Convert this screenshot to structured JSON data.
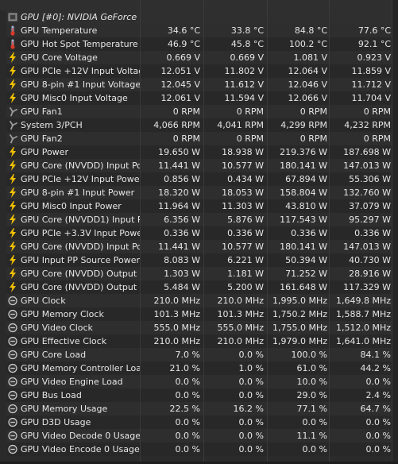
{
  "group": {
    "label": "GPU [#0]: NVIDIA GeForce ..."
  },
  "rows": [
    {
      "icon": "thermometer-icon",
      "label": "GPU Temperature",
      "current": "34.6 °C",
      "min": "33.8 °C",
      "max": "84.8 °C",
      "avg": "77.6 °C"
    },
    {
      "icon": "thermometer-icon",
      "label": "GPU Hot Spot Temperature",
      "current": "46.9 °C",
      "min": "45.8 °C",
      "max": "100.2 °C",
      "avg": "92.1 °C"
    },
    {
      "icon": "lightning-icon",
      "label": "GPU Core Voltage",
      "current": "0.669 V",
      "min": "0.669 V",
      "max": "1.081 V",
      "avg": "0.923 V"
    },
    {
      "icon": "lightning-icon",
      "label": "GPU PCIe +12V Input Voltage",
      "current": "12.051 V",
      "min": "11.802 V",
      "max": "12.064 V",
      "avg": "11.859 V"
    },
    {
      "icon": "lightning-icon",
      "label": "GPU 8-pin #1 Input Voltage",
      "current": "12.045 V",
      "min": "11.612 V",
      "max": "12.046 V",
      "avg": "11.712 V"
    },
    {
      "icon": "lightning-icon",
      "label": "GPU Misc0 Input Voltage",
      "current": "12.061 V",
      "min": "11.594 V",
      "max": "12.066 V",
      "avg": "11.704 V"
    },
    {
      "icon": "fan-icon",
      "label": "GPU Fan1",
      "current": "0 RPM",
      "min": "0 RPM",
      "max": "0 RPM",
      "avg": "0 RPM"
    },
    {
      "icon": "fan-icon",
      "label": "System 3/PCH",
      "current": "4,066 RPM",
      "min": "4,041 RPM",
      "max": "4,299 RPM",
      "avg": "4,232 RPM"
    },
    {
      "icon": "fan-icon",
      "label": "GPU Fan2",
      "current": "0 RPM",
      "min": "0 RPM",
      "max": "0 RPM",
      "avg": "0 RPM"
    },
    {
      "icon": "lightning-icon",
      "label": "GPU Power",
      "current": "19.650 W",
      "min": "18.938 W",
      "max": "219.376 W",
      "avg": "187.698 W"
    },
    {
      "icon": "lightning-icon",
      "label": "GPU Core (NVVDD) Input Po...",
      "current": "11.441 W",
      "min": "10.577 W",
      "max": "180.141 W",
      "avg": "147.013 W"
    },
    {
      "icon": "lightning-icon",
      "label": "GPU PCIe +12V Input Power",
      "current": "0.856 W",
      "min": "0.434 W",
      "max": "67.894 W",
      "avg": "55.306 W"
    },
    {
      "icon": "lightning-icon",
      "label": "GPU 8-pin #1 Input Power",
      "current": "18.320 W",
      "min": "18.053 W",
      "max": "158.804 W",
      "avg": "132.760 W"
    },
    {
      "icon": "lightning-icon",
      "label": "GPU Misc0 Input Power",
      "current": "11.964 W",
      "min": "11.303 W",
      "max": "43.810 W",
      "avg": "37.079 W"
    },
    {
      "icon": "lightning-icon",
      "label": "GPU Core (NVVDD1) Input P...",
      "current": "6.356 W",
      "min": "5.876 W",
      "max": "117.543 W",
      "avg": "95.297 W"
    },
    {
      "icon": "lightning-icon",
      "label": "GPU PCIe +3.3V Input Powe...",
      "current": "0.336 W",
      "min": "0.336 W",
      "max": "0.336 W",
      "avg": "0.336 W"
    },
    {
      "icon": "lightning-icon",
      "label": "GPU Core (NVVDD) Input Po...",
      "current": "11.441 W",
      "min": "10.577 W",
      "max": "180.141 W",
      "avg": "147.013 W"
    },
    {
      "icon": "lightning-icon",
      "label": "GPU Input PP Source Power ...",
      "current": "8.083 W",
      "min": "6.221 W",
      "max": "50.394 W",
      "avg": "40.730 W"
    },
    {
      "icon": "lightning-icon",
      "label": "GPU Core (NVVDD) Output P...",
      "current": "1.303 W",
      "min": "1.181 W",
      "max": "71.252 W",
      "avg": "28.916 W"
    },
    {
      "icon": "lightning-icon",
      "label": "GPU Core (NVVDD) Output P...",
      "current": "5.484 W",
      "min": "5.200 W",
      "max": "161.648 W",
      "avg": "117.329 W"
    },
    {
      "icon": "clock-icon",
      "label": "GPU Clock",
      "current": "210.0 MHz",
      "min": "210.0 MHz",
      "max": "1,995.0 MHz",
      "avg": "1,649.8 MHz"
    },
    {
      "icon": "clock-icon",
      "label": "GPU Memory Clock",
      "current": "101.3 MHz",
      "min": "101.3 MHz",
      "max": "1,750.2 MHz",
      "avg": "1,588.7 MHz"
    },
    {
      "icon": "clock-icon",
      "label": "GPU Video Clock",
      "current": "555.0 MHz",
      "min": "555.0 MHz",
      "max": "1,755.0 MHz",
      "avg": "1,512.0 MHz"
    },
    {
      "icon": "clock-icon",
      "label": "GPU Effective Clock",
      "current": "210.0 MHz",
      "min": "210.0 MHz",
      "max": "1,979.0 MHz",
      "avg": "1,641.0 MHz"
    },
    {
      "icon": "clock-icon",
      "label": "GPU Core Load",
      "current": "7.0 %",
      "min": "0.0 %",
      "max": "100.0 %",
      "avg": "84.1 %"
    },
    {
      "icon": "clock-icon",
      "label": "GPU Memory Controller Load",
      "current": "21.0 %",
      "min": "1.0 %",
      "max": "61.0 %",
      "avg": "44.2 %"
    },
    {
      "icon": "clock-icon",
      "label": "GPU Video Engine Load",
      "current": "0.0 %",
      "min": "0.0 %",
      "max": "10.0 %",
      "avg": "0.0 %"
    },
    {
      "icon": "clock-icon",
      "label": "GPU Bus Load",
      "current": "0.0 %",
      "min": "0.0 %",
      "max": "29.0 %",
      "avg": "2.4 %"
    },
    {
      "icon": "clock-icon",
      "label": "GPU Memory Usage",
      "current": "22.5 %",
      "min": "16.2 %",
      "max": "77.1 %",
      "avg": "64.7 %"
    },
    {
      "icon": "clock-icon",
      "label": "GPU D3D Usage",
      "current": "0.0 %",
      "min": "0.0 %",
      "max": "0.0 %",
      "avg": "0.0 %"
    },
    {
      "icon": "clock-icon",
      "label": "GPU Video Decode 0 Usage",
      "current": "0.0 %",
      "min": "0.0 %",
      "max": "11.1 %",
      "avg": "0.0 %"
    },
    {
      "icon": "clock-icon",
      "label": "GPU Video Encode 0 Usage",
      "current": "0.0 %",
      "min": "0.0 %",
      "max": "0.0 %",
      "avg": "0.0 %"
    }
  ],
  "colors": {
    "lightning": "#f2c200",
    "thermometer_bulb": "#d83a2a",
    "thermometer_tube": "#9fb6d6",
    "fan": "#9a9a9a",
    "clock": "#cfcfcf"
  }
}
